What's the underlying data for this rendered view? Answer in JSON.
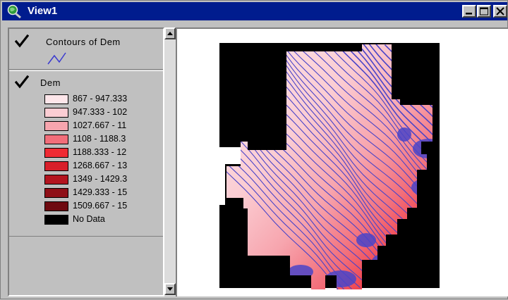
{
  "window": {
    "title": "View1",
    "icon": "globe-magnifier-icon",
    "controls": [
      "minimize-icon",
      "maximize-icon",
      "close-icon"
    ]
  },
  "toc": {
    "themes": [
      {
        "name": "Contours of Dem",
        "checked": true,
        "symbol": "contour-line-icon",
        "symbol_color": "#3a3ad0"
      },
      {
        "name": "Dem",
        "checked": true,
        "legend": [
          {
            "label": "867 - 947.333",
            "color": "#fde6ea"
          },
          {
            "label": "947.333 - 102",
            "color": "#fbcdd3"
          },
          {
            "label": "1027.667 - 11",
            "color": "#f7a5ae"
          },
          {
            "label": "1108 - 1188.3",
            "color": "#f26e7a"
          },
          {
            "label": "1188.333 - 12",
            "color": "#ef2a33"
          },
          {
            "label": "1268.667 - 13",
            "color": "#d81f2a"
          },
          {
            "label": "1349 - 1429.3",
            "color": "#b3141f"
          },
          {
            "label": "1429.333 - 15",
            "color": "#8f0f17"
          },
          {
            "label": "1509.667 - 15",
            "color": "#6e0a10"
          },
          {
            "label": "No Data",
            "color": "#000000"
          }
        ]
      }
    ]
  },
  "map": {
    "background": "#ffffff",
    "nodata_color": "#000000",
    "contour_color": "#4a44c8"
  }
}
